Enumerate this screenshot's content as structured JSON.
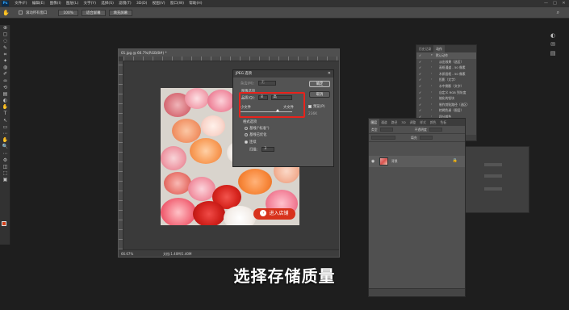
{
  "menubar": {
    "logo": "Ps",
    "items": [
      "文件(F)",
      "编辑(E)",
      "图像(I)",
      "图层(L)",
      "文字(Y)",
      "选择(S)",
      "滤镜(T)",
      "3D(D)",
      "视图(V)",
      "窗口(W)",
      "帮助(H)"
    ],
    "window_controls": [
      "—",
      "□",
      "✕"
    ]
  },
  "optionsbar": {
    "tool_icon": "hand-tool-icon",
    "checkbox_label": "滚动所有窗口",
    "zoom_button": "100%",
    "fit_button": "适合屏幕",
    "fill_button": "填充屏幕",
    "right_icon": "search-icon"
  },
  "toolbar": {
    "tools": [
      "⊕",
      "▢",
      "◌",
      "✎",
      "⌗",
      "✦",
      "◍",
      "✐",
      "♒",
      "⟲",
      "▤",
      "◐",
      "✋",
      "T",
      "↖",
      "▭",
      "⋯",
      "✋",
      "🔍",
      "⋯",
      "⚙",
      "◫",
      "⬚",
      "▣"
    ],
    "foreground_color": "#d3401a",
    "background_color": "#eeeeee"
  },
  "right_strip": {
    "icons": [
      "◐",
      "✉",
      "▤"
    ]
  },
  "document": {
    "tab_title": "01.jpg @ 66.7%(RGB/8#) *",
    "zoom": "66.67%",
    "doc_info": "文档:1.40M/1.40M",
    "cta_label": "进入店铺",
    "cta_arrow": "›"
  },
  "jpeg_dialog": {
    "title": "JPEG 选项",
    "close": "✕",
    "matte_label": "杂边(M):",
    "matte_value": "无",
    "image_options_label": "图像选项",
    "quality_label": "品质(Q):",
    "quality_value": "8",
    "quality_level": "高",
    "small_file": "小文件",
    "large_file": "大文件",
    "format_options_label": "格式选项",
    "format_baseline": "基线(\"标准\")",
    "format_optimized": "基线已优化",
    "format_progressive": "连续",
    "scans_label": "扫描:",
    "scans_value": "3",
    "ok_button": "确定",
    "cancel_button": "取消",
    "preview_label": "预览(P)",
    "file_size": "236K",
    "quality_fraction": 0.72
  },
  "history_panel": {
    "tabs": [
      "历史记录",
      "动作"
    ],
    "actions": [
      "默认动作",
      "淡出效果（选区）",
      "画框通道 - 50 像素",
      "木质画框 - 50 像素",
      "投影（文字）",
      "水中倒影（文字）",
      "自定义 RGB 到灰度",
      "熔化的铅块",
      "制作剪贴路径（选区）",
      "棕褐色调（图层）",
      "四分颜色"
    ]
  },
  "layers_panel": {
    "tabs": [
      "图层",
      "通道",
      "路径",
      "3D",
      "调整",
      "样式",
      "颜色",
      "色板"
    ],
    "filter_label": "类型",
    "opacity_label": "不透明度",
    "fill_label": "填充",
    "layer_name": "背景"
  },
  "subtitle": "选择存储质量"
}
